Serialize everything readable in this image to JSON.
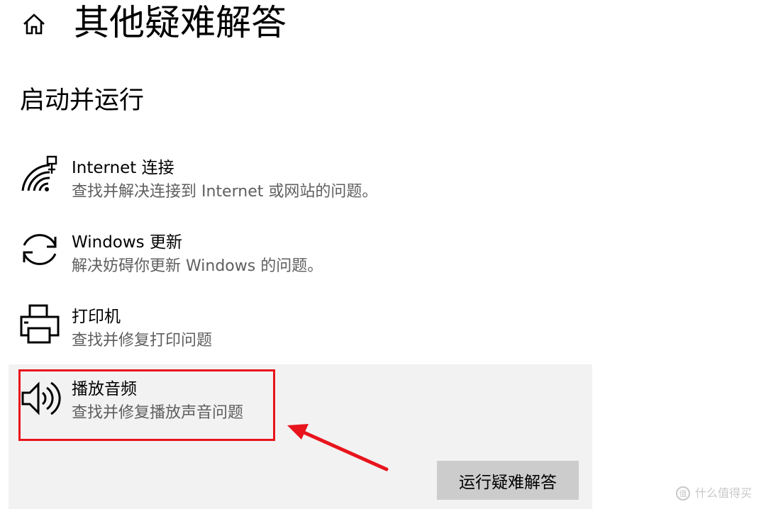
{
  "page": {
    "title": "其他疑难解答"
  },
  "section": {
    "title": "启动并运行"
  },
  "items": [
    {
      "title": "Internet 连接",
      "description": "查找并解决连接到 Internet 或网站的问题。",
      "icon": "network-icon"
    },
    {
      "title": "Windows 更新",
      "description": "解决妨碍你更新 Windows 的问题。",
      "icon": "sync-icon"
    },
    {
      "title": "打印机",
      "description": "查找并修复打印问题",
      "icon": "printer-icon"
    },
    {
      "title": "播放音频",
      "description": "查找并修复播放声音问题",
      "icon": "speaker-icon",
      "selected": true
    }
  ],
  "actions": {
    "run_troubleshooter": "运行疑难解答"
  },
  "watermark": {
    "text": "什么值得买"
  },
  "colors": {
    "annotation_red": "#e8141c",
    "selected_item_bg": "#f2f2f2",
    "button_bg": "#cccccc",
    "description_text": "#5f5f5f"
  }
}
